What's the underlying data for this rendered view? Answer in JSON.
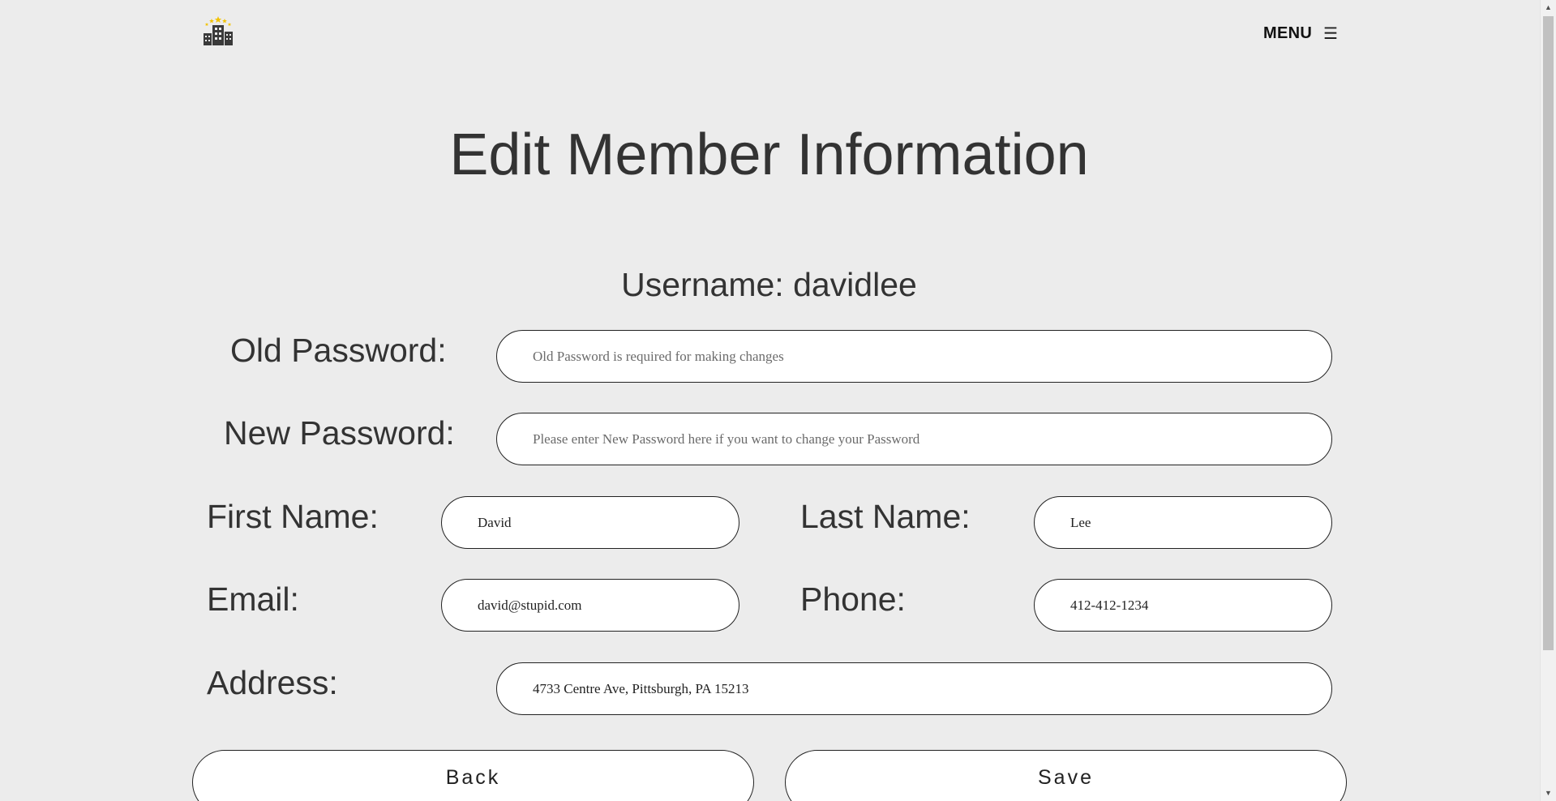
{
  "header": {
    "logo_icon": "hotel-building-stars-icon",
    "menu_label": "MENU",
    "menu_icon": "☰"
  },
  "main": {
    "title": "Edit Member Information",
    "username_label": "Username: davidlee"
  },
  "form": {
    "old_password": {
      "label": "Old Password:",
      "value": "",
      "placeholder": "Old Password is required for making changes"
    },
    "new_password": {
      "label": "New Password:",
      "value": "",
      "placeholder": "Please enter New Password here if you want to change your Password"
    },
    "first_name": {
      "label": "First Name:",
      "value": "David"
    },
    "last_name": {
      "label": "Last Name:",
      "value": "Lee"
    },
    "email": {
      "label": "Email:",
      "value": "david@stupid.com"
    },
    "phone": {
      "label": "Phone:",
      "value": "412-412-1234"
    },
    "address": {
      "label": "Address:",
      "value": "4733 Centre Ave, Pittsburgh, PA 15213"
    }
  },
  "actions": {
    "back_label": "Back",
    "save_label": "Save"
  },
  "colors": {
    "background": "#ececec",
    "text": "#333333",
    "field_background": "#ffffff",
    "field_border": "#222222",
    "logo_star": "#f2c200",
    "logo_building": "#3a3a3a"
  }
}
